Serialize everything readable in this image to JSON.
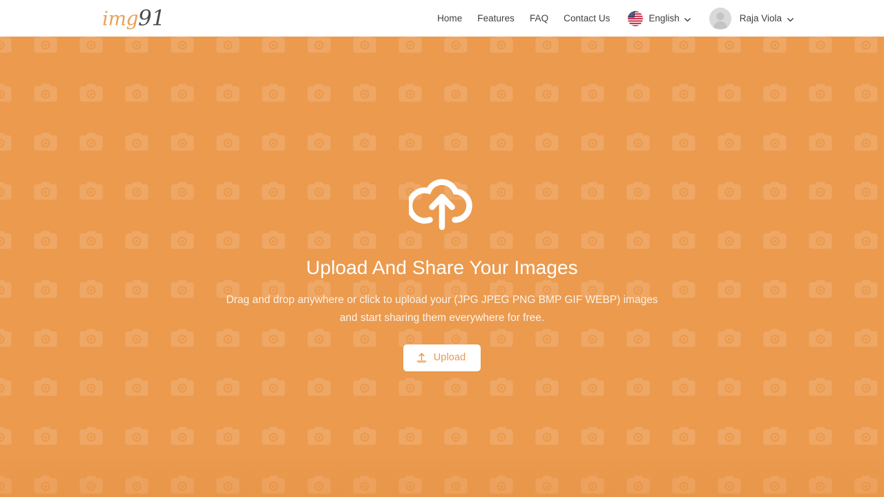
{
  "brand": {
    "logo_text_primary": "img",
    "logo_text_secondary": "91",
    "accent_color": "#e8a15a",
    "hero_bg_color": "#eb9a4e"
  },
  "header": {
    "nav_links": [
      {
        "label": "Home",
        "name": "nav-link-home"
      },
      {
        "label": "Features",
        "name": "nav-link-features"
      },
      {
        "label": "FAQ",
        "name": "nav-link-faq"
      },
      {
        "label": "Contact Us",
        "name": "nav-link-contact-us"
      }
    ],
    "language_selector": {
      "label": "English",
      "flag": "us-flag-icon",
      "chevron": "chevron-down-icon"
    },
    "user_menu": {
      "name": "Raja Viola",
      "avatar": "default-user-avatar",
      "chevron": "chevron-down-icon"
    }
  },
  "hero": {
    "icon": "cloud-upload-icon",
    "title": "Upload And Share Your Images",
    "subtitle_line_1": "Drag and drop anywhere or click to upload your (JPG JPEG PNG BMP GIF WEBP)",
    "subtitle_line_2": "images and start sharing them everywhere for free.",
    "upload_button": {
      "label": "Upload",
      "icon": "upload-arrow-icon",
      "text_color": "#e8994c"
    },
    "background_pattern": "camera-icon-tile"
  }
}
